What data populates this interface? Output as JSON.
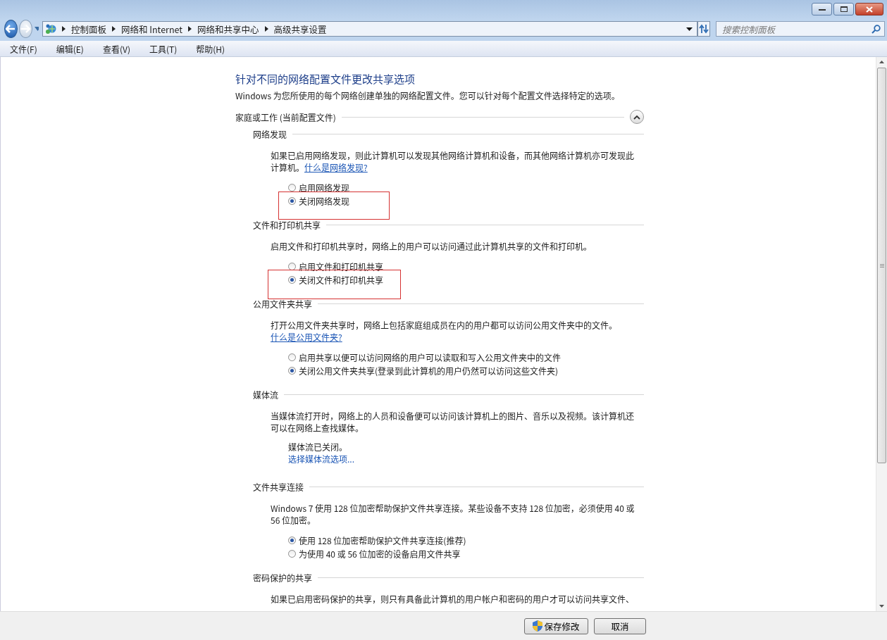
{
  "address_bar": {
    "breadcrumbs": [
      "控制面板",
      "网络和 Internet",
      "网络和共享中心",
      "高级共享设置"
    ],
    "search_placeholder": "搜索控制面板"
  },
  "menu": [
    "文件(F)",
    "编辑(E)",
    "查看(V)",
    "工具(T)",
    "帮助(H)"
  ],
  "page": {
    "title": "针对不同的网络配置文件更改共享选项",
    "intro": "Windows 为您所使用的每个网络创建单独的网络配置文件。您可以针对每个配置文件选择特定的选项。",
    "profile": {
      "label": "家庭或工作 (当前配置文件)",
      "expanded": true
    },
    "sections": [
      {
        "kind": "options",
        "heading": "网络发现",
        "description": "如果已启用网络发现，则此计算机可以发现其他网络计算机和设备，而其他网络计算机亦可发现此计算机。",
        "link": "什么是网络发现?",
        "options": [
          {
            "label": "启用网络发现",
            "selected": false,
            "annotated": false
          },
          {
            "label": "关闭网络发现",
            "selected": true,
            "annotated": true
          }
        ]
      },
      {
        "kind": "options",
        "heading": "文件和打印机共享",
        "description": "启用文件和打印机共享时，网络上的用户可以访问通过此计算机共享的文件和打印机。",
        "options": [
          {
            "label": "启用文件和打印机共享",
            "selected": false,
            "annotated": false
          },
          {
            "label": "关闭文件和打印机共享",
            "selected": true,
            "annotated": true
          }
        ]
      },
      {
        "kind": "options",
        "heading": "公用文件夹共享",
        "description": "打开公用文件夹共享时，网络上包括家庭组成员在内的用户都可以访问公用文件夹中的文件。",
        "link": "什么是公用文件夹?",
        "options": [
          {
            "label": "启用共享以便可以访问网络的用户可以读取和写入公用文件夹中的文件",
            "selected": false,
            "annotated": false
          },
          {
            "label": "关闭公用文件夹共享(登录到此计算机的用户仍然可以访问这些文件夹)",
            "selected": true,
            "annotated": false
          }
        ]
      },
      {
        "kind": "status",
        "heading": "媒体流",
        "description": "当媒体流打开时，网络上的人员和设备便可以访问该计算机上的图片、音乐以及视频。该计算机还可以在网络上查找媒体。",
        "status": "媒体流已关闭。",
        "link": "选择媒体流选项..."
      },
      {
        "kind": "options",
        "heading": "文件共享连接",
        "description": "Windows 7 使用 128 位加密帮助保护文件共享连接。某些设备不支持 128 位加密，必须使用 40 或 56 位加密。",
        "options": [
          {
            "label": "使用 128 位加密帮助保护文件共享连接(推荐)",
            "selected": true,
            "annotated": false
          },
          {
            "label": "为使用 40 或 56 位加密的设备启用文件共享",
            "selected": false,
            "annotated": false
          }
        ]
      },
      {
        "kind": "text",
        "heading": "密码保护的共享",
        "description": "如果已启用密码保护的共享，则只有具备此计算机的用户帐户和密码的用户才可以访问共享文件、"
      }
    ]
  },
  "buttons": [
    {
      "label": "保存修改",
      "kind": "shield"
    },
    {
      "label": "取消",
      "kind": "plain"
    }
  ]
}
